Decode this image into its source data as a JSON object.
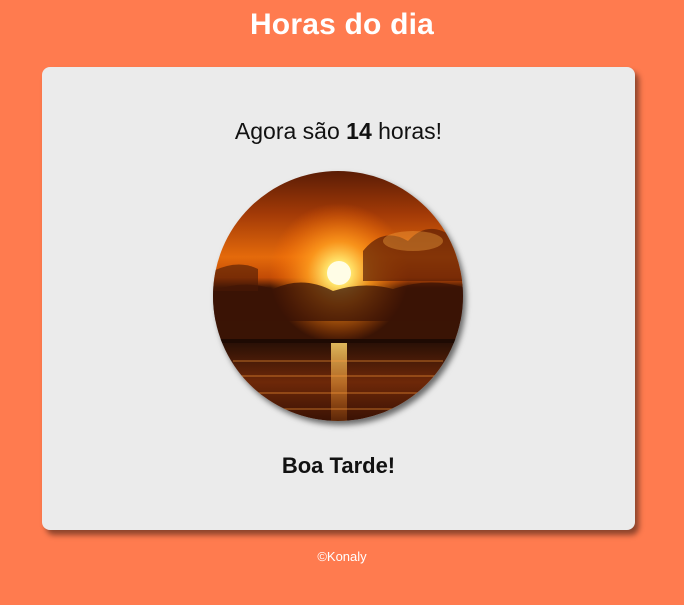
{
  "header": {
    "title": "Horas do dia"
  },
  "main": {
    "time_prefix": "Agora são",
    "hour": "14",
    "time_suffix": "horas!",
    "image_icon": "sunset-image",
    "greeting": "Boa Tarde!"
  },
  "footer": {
    "copyright": "©Konaly"
  },
  "colors": {
    "background": "#ff7b4f",
    "card": "#ebebeb",
    "title_text": "#ffffff"
  }
}
